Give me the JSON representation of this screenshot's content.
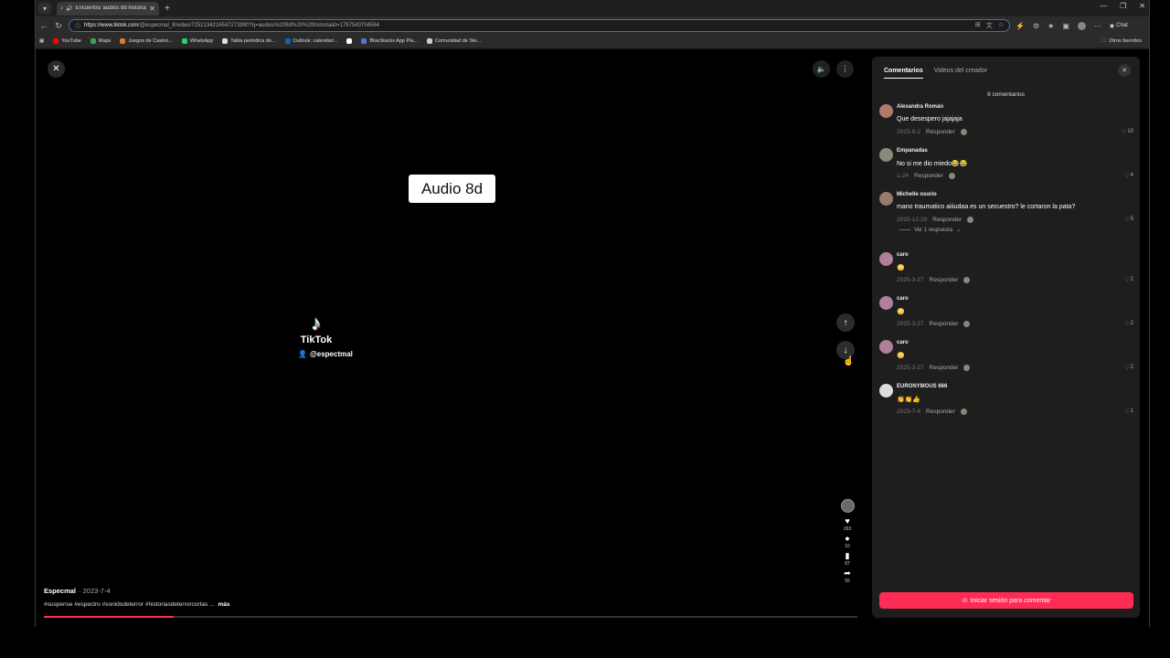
{
  "browser": {
    "tab_title": "Encuentra 'audios 8d historia'...",
    "url_domain": "https://www.tiktok.com",
    "url_path": "/@especmal_8/video/7252134216547273990?q=audios%208d%20%20historia&t=1787543704564",
    "chat_label": "Chat",
    "bookmarks": [
      "YouTube",
      "Maps",
      "Juegos de Casino...",
      "WhatsApp",
      "Tabla periódica de...",
      "Outlook: calendari...",
      "",
      "BlueStacks App Pla...",
      "Comunidad de Ste..."
    ],
    "bookmark_colors": [
      "#ff0000",
      "#34a853",
      "#e6762f",
      "#25d366",
      "#dddddd",
      "#0a66c2",
      "#ffffff",
      "#4a7bd0",
      "#cccccc"
    ],
    "other_favorites": "Otros favoritos"
  },
  "video": {
    "audio_label": "Audio 8d",
    "watermark_brand": "TikTok",
    "watermark_user": "@espectmal",
    "author": "Especmal",
    "date": "· 2023-7-4",
    "tags": "#suspense #espectro #sonidodeterror #historiasdeterrorcortas ...",
    "more": "más",
    "progress_percent": 16,
    "likes": "263",
    "comments": "10",
    "saves": "87",
    "shares": "55"
  },
  "panel": {
    "tab_comments": "Comentarios",
    "tab_creator_videos": "Videos del creador",
    "comment_count": "8 comentarios",
    "reply_label": "Responder",
    "view_reply": "Ver 1 respuesta",
    "login_button": "Iniciar sesión para comentar",
    "comments": [
      {
        "user": "Alexandra Román",
        "text": "Que desespero jajajaja",
        "date": "2023-9-2",
        "likes": "10",
        "color": "#b07a6a"
      },
      {
        "user": "Empanadas",
        "text": "No si me dio miedo😂😂",
        "date": "1-24",
        "likes": "4",
        "color": "#8a8a7a"
      },
      {
        "user": "Michelle osorio",
        "text": "mano traumatico aiiiudaa es un secuestro? le cortaron la pata?",
        "date": "2025-12-29",
        "likes": "5",
        "color": "#9a7a6a"
      },
      {
        "user": "caro",
        "text": "😳",
        "date": "2025-3-27",
        "likes": "2",
        "color": "#b0809a"
      },
      {
        "user": "caro",
        "text": "😳",
        "date": "2025-3-27",
        "likes": "2",
        "color": "#b0809a"
      },
      {
        "user": "caro",
        "text": "😳",
        "date": "2025-3-27",
        "likes": "2",
        "color": "#b0809a"
      },
      {
        "user": "EURONYMOUS 666",
        "text": "👏👏👍",
        "date": "2023-7-4",
        "likes": "1",
        "color": "#dddddd"
      }
    ]
  }
}
